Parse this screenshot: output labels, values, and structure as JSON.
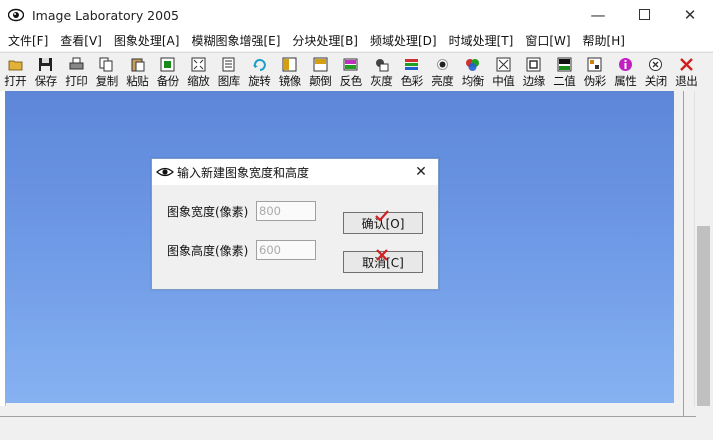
{
  "window": {
    "title": "Image Laboratory 2005",
    "minimize_icon": "minimize-icon",
    "maximize_icon": "maximize-icon",
    "close_icon": "close-icon"
  },
  "menu": [
    {
      "label": "文件[F]"
    },
    {
      "label": "查看[V]"
    },
    {
      "label": "图象处理[A]"
    },
    {
      "label": "模糊图象增强[E]"
    },
    {
      "label": "分块处理[B]"
    },
    {
      "label": "频域处理[D]"
    },
    {
      "label": "时域处理[T]"
    },
    {
      "label": "窗口[W]"
    },
    {
      "label": "帮助[H]"
    }
  ],
  "toolbar": [
    {
      "label": "打开",
      "icon": "open-folder-icon",
      "color": "#e2b13c"
    },
    {
      "label": "保存",
      "icon": "save-disk-icon",
      "color": "#222222"
    },
    {
      "label": "打印",
      "icon": "printer-icon",
      "color": "#333333"
    },
    {
      "label": "复制",
      "icon": "copy-icon",
      "color": "#333333"
    },
    {
      "label": "粘贴",
      "icon": "paste-icon",
      "color": "#333333"
    },
    {
      "label": "备份",
      "icon": "backup-icon",
      "color": "#1a8a1a"
    },
    {
      "label": "缩放",
      "icon": "zoom-icon",
      "color": "#333333"
    },
    {
      "label": "图库",
      "icon": "gallery-icon",
      "color": "#333333"
    },
    {
      "label": "旋转",
      "icon": "rotate-icon",
      "color": "#1aa0c8"
    },
    {
      "label": "镜像",
      "icon": "mirror-icon",
      "color": "#d4a010"
    },
    {
      "label": "颠倒",
      "icon": "flip-icon",
      "color": "#d4a010"
    },
    {
      "label": "反色",
      "icon": "invert-icon",
      "color": "#c030c0"
    },
    {
      "label": "灰度",
      "icon": "grayscale-icon",
      "color": "#444444"
    },
    {
      "label": "色彩",
      "icon": "color-icon",
      "color": "#2060d0"
    },
    {
      "label": "亮度",
      "icon": "brightness-icon",
      "color": "#222222"
    },
    {
      "label": "均衡",
      "icon": "equalize-icon",
      "color": "#d03030"
    },
    {
      "label": "中值",
      "icon": "median-icon",
      "color": "#333333"
    },
    {
      "label": "边缘",
      "icon": "edge-icon",
      "color": "#333333"
    },
    {
      "label": "二值",
      "icon": "binary-icon",
      "color": "#1a8a1a"
    },
    {
      "label": "伪彩",
      "icon": "pseudo-color-icon",
      "color": "#d08010"
    },
    {
      "label": "属性",
      "icon": "properties-icon",
      "color": "#c020c0"
    },
    {
      "label": "关闭",
      "icon": "close-doc-icon",
      "color": "#333333"
    },
    {
      "label": "退出",
      "icon": "exit-icon",
      "color": "#d02020"
    }
  ],
  "dialog": {
    "title": "输入新建图象宽度和高度",
    "width_label": "图象宽度(像素)",
    "width_value": "800",
    "height_label": "图象高度(像素)",
    "height_value": "600",
    "ok_label": "确认[O]",
    "cancel_label": "取消[C]",
    "close_icon": "close-icon"
  },
  "colors": {
    "canvas_top": "#5d86d9",
    "canvas_bottom": "#86b2f2",
    "ok_check": "#d02020",
    "cancel_cross": "#d02020"
  }
}
